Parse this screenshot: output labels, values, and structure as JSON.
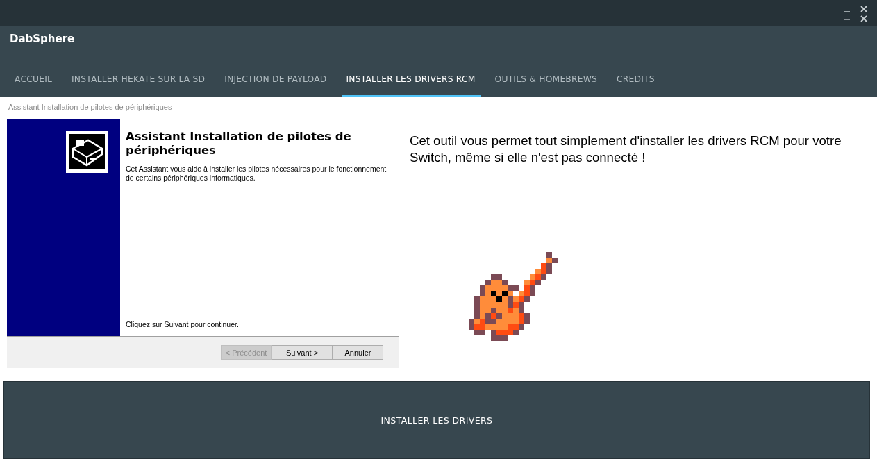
{
  "window": {
    "title": "DabSphere"
  },
  "tabs": [
    {
      "label": "ACCUEIL",
      "selected": false
    },
    {
      "label": "INSTALLER HEKATE SUR LA SD",
      "selected": false
    },
    {
      "label": "INJECTION DE PAYLOAD",
      "selected": false
    },
    {
      "label": "INSTALLER LES DRIVERS RCM",
      "selected": true
    },
    {
      "label": "OUTILS & HOMEBREWS",
      "selected": false
    },
    {
      "label": "CREDITS",
      "selected": false
    }
  ],
  "wizard": {
    "caption": "Assistant Installation de pilotes de périphériques",
    "title": "Assistant Installation de pilotes de périphériques",
    "description": "Cet Assistant vous aide à installer les pilotes nécessaires pour le fonctionnement de certains périphériques informatiques.",
    "hint": "Cliquez sur Suivant pour continuer.",
    "buttons": [
      {
        "label": "< Précédent",
        "disabled": true
      },
      {
        "label": "Suivant >",
        "disabled": false
      },
      {
        "label": "Annuler",
        "disabled": false
      }
    ]
  },
  "info": "Cet outil vous permet tout simplement d'installer les drivers RCM pour votre Switch, même si elle n'est pas connecté !",
  "install_button": "INSTALLER LES DRIVERS"
}
